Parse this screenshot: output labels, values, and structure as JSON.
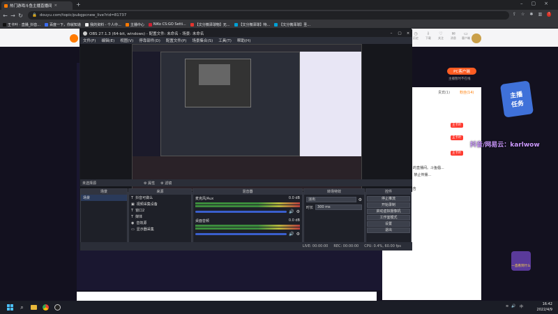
{
  "browser": {
    "tab_title": "热门游戏斗鱼主播直播间",
    "url": "douyu.com/topic/pubgpcnew_live?rid=81737",
    "bookmarks": [
      "王卡叶 · 直播_抖音...",
      "百度一下，你就知道",
      "我的资料 - 个人中...",
      "主播中心",
      "NiKo CS:GO Setti...",
      "【文分微泽球物】无...",
      "【文分微泽球】特...",
      "【文分微泽球】圣..."
    ],
    "colors": {
      "tabstrip": "#202124",
      "toolbar": "#35363a"
    }
  },
  "douyu": {
    "header_icons": [
      "历史",
      "下载",
      "关注",
      "消息",
      "客户端"
    ],
    "pc_button": "PC客户端",
    "pc_sub": "主播暂时不在线",
    "panel_tabs": [
      "贵宾(1)",
      "粉丝(14)"
    ],
    "panel_badge": "王卡叶",
    "panel_lines": [
      "欢迎来到王卡叶：的直播间。斗鱼倡...",
      "坚持24小时互动，禁止传播...",
      "...",
      "小王子，私下...公告"
    ],
    "watermark": "抖音/网易云：karlwow",
    "badge_text": "一直看到什么"
  },
  "obs": {
    "title": "OBS 27.1.3 (64-bit, windows) - 配置文件: 未命名 - 场景: 未命名",
    "menu": [
      "文件(F)",
      "编辑(E)",
      "视图(V)",
      "停靠部件(D)",
      "配置文件(P)",
      "场景集合(S)",
      "工具(T)",
      "帮助(H)"
    ],
    "source_label": "未选择源",
    "props_label": "属性",
    "filters_label": "滤镜",
    "docks": {
      "scenes": {
        "title": "场景",
        "items": [
          "场景"
        ]
      },
      "sources": {
        "title": "来源",
        "items": [
          "抖音可做么",
          "视频采集设备",
          "窗口2",
          "媒体",
          "音效源",
          "显示器采集"
        ]
      },
      "mixer": {
        "title": "混音器",
        "channels": [
          {
            "name": "麦克风/Aux",
            "level": "0.0 dB"
          },
          {
            "name": "桌面音频",
            "level": "0.0 dB"
          }
        ]
      },
      "transitions": {
        "title": "转场特效",
        "type": "淡出",
        "duration_label": "时长",
        "duration": "300 ms"
      },
      "controls": {
        "title": "控件",
        "buttons": [
          "停止推流",
          "开始录制",
          "启动虚拟摄像机",
          "工作室模式",
          "设置",
          "退出"
        ]
      }
    },
    "status": {
      "live": "LIVE: 00:00:00",
      "rec": "REC: 00:00:00",
      "cpu": "CPU: 0.4%, 60.00 fps"
    }
  },
  "taskbar": {
    "time": "16:42",
    "date": "2022/4/9",
    "lang": "中"
  }
}
